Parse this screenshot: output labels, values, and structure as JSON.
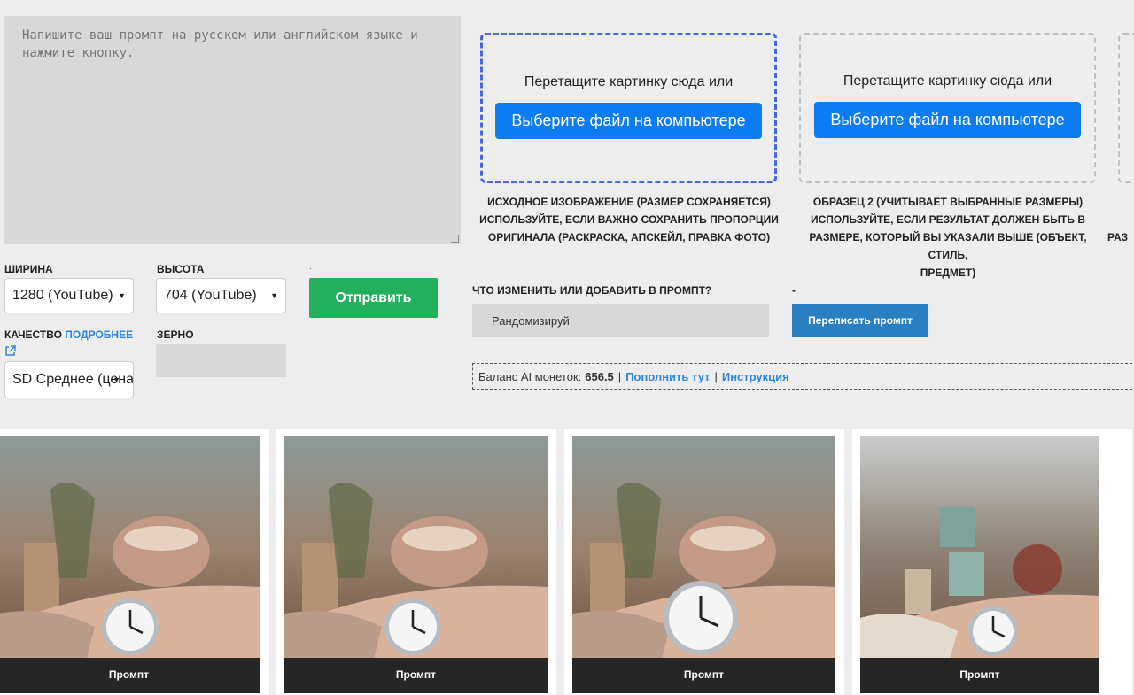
{
  "prompt": {
    "placeholder": "Напишите ваш промпт на русском или английском языке и\nнажмите кнопку."
  },
  "dropzones": [
    {
      "text": "Перетащите картинку сюда или",
      "button": "Выберите файл на компьютере"
    },
    {
      "text": "Перетащите картинку сюда или",
      "button": "Выберите файл на компьютере"
    }
  ],
  "captions": {
    "source_line1": "ИСХОДНОЕ ИЗОБРАЖЕНИЕ (РАЗМЕР СОХРАНЯЕТСЯ)",
    "source_line2": "ИСПОЛЬЗУЙТЕ, ЕСЛИ ВАЖНО СОХРАНИТЬ ПРОПОРЦИИ",
    "source_line3": "ОРИГИНАЛА (РАСКРАСКА, АПСКЕЙЛ, ПРАВКА ФОТО)",
    "sample2_line1": "ОБРАЗЕЦ 2 (УЧИТЫВАЕТ ВЫБРАННЫЕ РАЗМЕРЫ)",
    "sample2_line2": "ИСПОЛЬЗУЙТЕ, ЕСЛИ РЕЗУЛЬТАТ ДОЛЖЕН БЫТЬ В",
    "sample2_line3": "РАЗМЕРЕ, КОТОРЫЙ ВЫ УКАЗАЛИ ВЫШЕ (ОБЪЕКТ, СТИЛЬ,",
    "sample2_line4": "ПРЕДМЕТ)",
    "sample3_partial": "РАЗ"
  },
  "settings": {
    "width_label": "ШИРИНА",
    "width_value": "1280 (YouTube)",
    "height_label": "ВЫСОТА",
    "height_value": "704 (YouTube)",
    "quality_label": "КАЧЕСТВО",
    "quality_more": "ПОДРОБНЕЕ",
    "quality_value": "SD Среднее (цена-",
    "grain_label": "ЗЕРНО",
    "dot": ".",
    "send_label": "Отправить"
  },
  "change": {
    "label": "ЧТО ИЗМЕНИТЬ ИЛИ ДОБАВИТЬ В ПРОМПТ?",
    "dash": "-",
    "input_value": "Рандомизируй",
    "rewrite_label": "Переписать промпт"
  },
  "balance": {
    "label": "Баланс AI монеток:",
    "value": "656.5",
    "sep": "|",
    "topup": "Пополнить тут",
    "instruction": "Инструкция"
  },
  "gallery": [
    {
      "caption": "Промпт"
    },
    {
      "caption": "Промпт"
    },
    {
      "caption": "Промпт"
    },
    {
      "caption": "Промпт"
    }
  ],
  "colors": {
    "primary_blue": "#0d7cf2",
    "send_green": "#22b05c",
    "rewrite_blue": "#2b7fc0",
    "link_blue": "#2f86d9"
  }
}
